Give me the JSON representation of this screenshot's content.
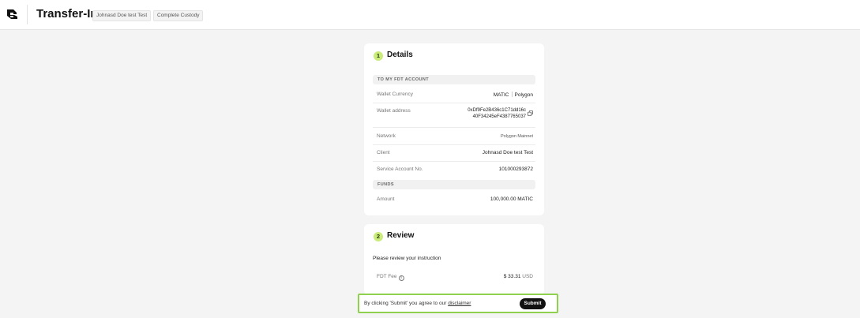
{
  "header": {
    "title": "Transfer-In",
    "client_badge": "Johnasd Doe test Test",
    "custody_badge": "Complete Custody"
  },
  "details": {
    "step": "1",
    "title": "Details",
    "section_account": "TO MY FDT ACCOUNT",
    "rows": {
      "currency_label": "Wallet Currency",
      "currency_value": "MATIC",
      "currency_chain": "Polygon",
      "address_label": "Wallet address",
      "address_line1": "0xDf9Fe2B436c1C71dd16c",
      "address_line2": "40F34245eF4387765037",
      "network_label": "Network",
      "network_value": "Polygon Mainnet",
      "client_label": "Client",
      "client_value": "Johnasd Doe test Test",
      "account_label": "Service Account No.",
      "account_value": "101000293872"
    },
    "section_funds": "FUNDS",
    "amount_label": "Amount",
    "amount_value": "100,000.00 MATIC"
  },
  "review": {
    "step": "2",
    "title": "Review",
    "instruction": "Please review your instruction",
    "fee_label": "FDT Fee",
    "fee_value": "$ 33.31",
    "fee_currency": "USD"
  },
  "footer": {
    "disclaimer_prefix": "By clicking 'Submit' you agree to our",
    "disclaimer_link": "disclaimer",
    "submit_label": "Submit"
  },
  "colors": {
    "accent": "#c9ec7a",
    "highlight_border": "#8fd14f",
    "button": "#111111"
  }
}
